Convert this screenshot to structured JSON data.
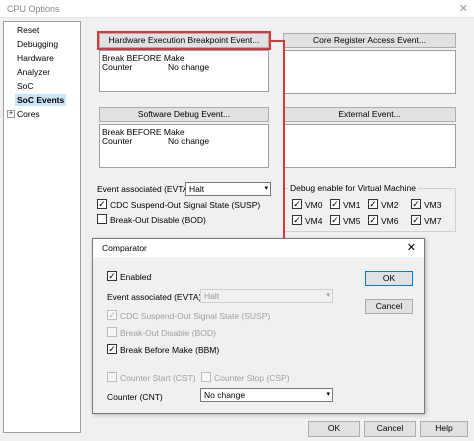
{
  "window": {
    "title": "CPU Options",
    "close_glyph": "✕"
  },
  "tree": {
    "items": [
      "Reset",
      "Debugging",
      "Hardware",
      "Analyzer",
      "SoC",
      "SoC Events",
      "Cores"
    ],
    "expander": "+"
  },
  "events": {
    "hw_bp_button": "Hardware Execution Breakpoint Event...",
    "core_reg_button": "Core Register Access Event...",
    "sw_debug_button": "Software Debug Event...",
    "external_button": "External Event...",
    "hw_bp_box": {
      "line1": "Break BEFORE Make",
      "line2_label": "Counter",
      "line2_value": "No change"
    },
    "sw_box": {
      "line1": "Break BEFORE Make",
      "line2_label": "Counter",
      "line2_value": "No change"
    }
  },
  "evta": {
    "label": "Event associated (EVTA)",
    "value": "Halt"
  },
  "checks": {
    "cdc": "CDC Suspend-Out Signal State (SUSP)",
    "bod": "Break-Out Disable (BOD)"
  },
  "vm_group": {
    "title": "Debug enable for Virtual Machine",
    "vms": [
      "VM0",
      "VM1",
      "VM2",
      "VM3",
      "VM4",
      "VM5",
      "VM6",
      "VM7"
    ]
  },
  "check_glyph": "✓",
  "dialog": {
    "title": "Comparator",
    "close_glyph": "✕",
    "enabled": "Enabled",
    "evta_label": "Event associated (EVTA)",
    "evta_value": "Halt",
    "cdc": "CDC Suspend-Out Signal State (SUSP)",
    "bod": "Break-Out Disable (BOD)",
    "bbm": "Break Before Make (BBM)",
    "counter_start": "Counter Start (CST)",
    "counter_stop": "Counter Stop (CSP)",
    "counter_label": "Counter (CNT)",
    "counter_value": "No change",
    "ok": "OK",
    "cancel": "Cancel"
  },
  "footer": {
    "ok": "OK",
    "cancel": "Cancel",
    "help": "Help"
  },
  "dropdown_glyph": "▾",
  "accent": "#d9363e"
}
